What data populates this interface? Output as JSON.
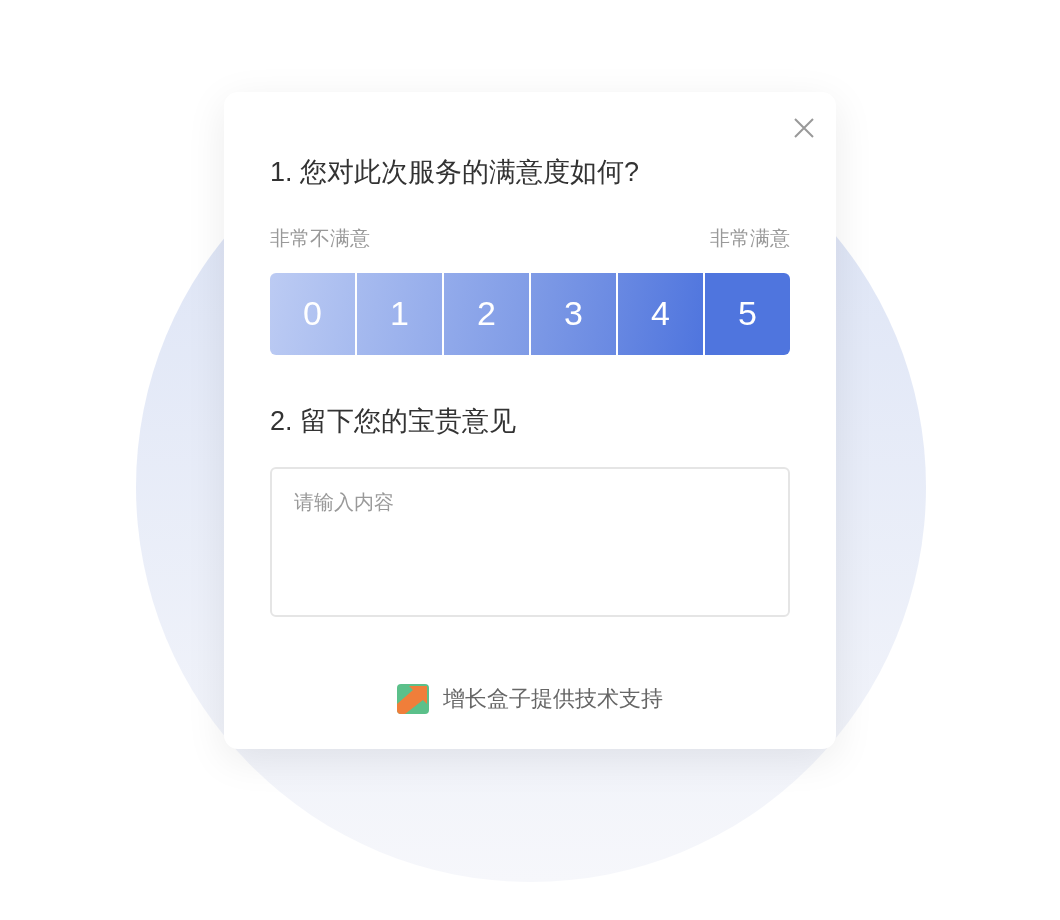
{
  "survey": {
    "questions": [
      {
        "kind": "scale",
        "title": "1. 您对此次服务的满意度如何?",
        "min_label": "非常不满意",
        "max_label": "非常满意",
        "options": [
          {
            "label": "0",
            "color": "#bccbf3"
          },
          {
            "label": "1",
            "color": "#a7bbef"
          },
          {
            "label": "2",
            "color": "#93abeb"
          },
          {
            "label": "3",
            "color": "#7f9be6"
          },
          {
            "label": "4",
            "color": "#6989e2"
          },
          {
            "label": "5",
            "color": "#4f75de"
          }
        ]
      },
      {
        "kind": "text",
        "title": "2. 留下您的宝贵意见",
        "placeholder": "请输入内容"
      }
    ],
    "footer": "增长盒子提供技术支持"
  }
}
